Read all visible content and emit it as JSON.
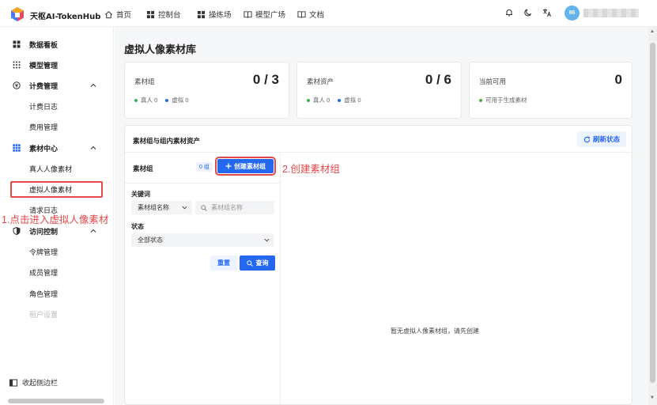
{
  "topbar": {
    "brand": "天枢AI-TokenHub",
    "nav": [
      {
        "label": "首页",
        "icon": "home-icon"
      },
      {
        "label": "控制台",
        "icon": "dashboard-icon"
      },
      {
        "label": "操练场",
        "icon": "grid-icon"
      },
      {
        "label": "模型广场",
        "icon": "book-icon"
      },
      {
        "label": "文档",
        "icon": "docs-icon"
      }
    ],
    "avatar_text": "96"
  },
  "sidebar": {
    "items": [
      {
        "label": "数据看板",
        "icon": "dashboard-icon"
      },
      {
        "label": "模型管理",
        "icon": "grid-dots-icon"
      },
      {
        "label": "计费管理",
        "icon": "billing-icon"
      },
      {
        "label": "计费日志"
      },
      {
        "label": "费用管理"
      },
      {
        "label": "素材中心",
        "icon": "grid-icon"
      },
      {
        "label": "真人人像素材"
      },
      {
        "label": "虚拟人像素材"
      },
      {
        "label": "请求日志"
      },
      {
        "label": "访问控制",
        "icon": "shield-icon"
      },
      {
        "label": "令牌管理"
      },
      {
        "label": "成员管理"
      },
      {
        "label": "角色管理"
      },
      {
        "label": "租户设置"
      }
    ],
    "collapse_label": "收起侧边栏",
    "annotation": "1.点击进入虚拟人像素材"
  },
  "main": {
    "page_title": "虚拟人像素材库",
    "cards": [
      {
        "title": "素材组",
        "value": "0 / 3",
        "legend": [
          {
            "label": "真人 0",
            "color": "#3bb54a"
          },
          {
            "label": "虚拟 0",
            "color": "#2468f2"
          }
        ]
      },
      {
        "title": "素材资产",
        "value": "0 / 6",
        "legend": [
          {
            "label": "真人 0",
            "color": "#3bb54a"
          },
          {
            "label": "虚拟 0",
            "color": "#2468f2"
          }
        ]
      },
      {
        "title": "当前可用",
        "value": "0",
        "legend": [
          {
            "label": "可用于生成素材",
            "color": "#3bb54a"
          }
        ]
      }
    ],
    "panel": {
      "title": "素材组与组内素材资产",
      "refresh_label": "刷新状态",
      "list_title": "素材组",
      "count_badge": "0 组",
      "create_label": "创建素材组",
      "annotation": "2.创建素材组",
      "keyword_label": "关键词",
      "keyword_select": "素材组名称",
      "search_placeholder": "素材组名称",
      "status_label": "状态",
      "status_select": "全部状态",
      "reset_label": "重置",
      "query_label": "查询",
      "empty_text": "暂无虚拟人像素材组，请先创建"
    }
  }
}
